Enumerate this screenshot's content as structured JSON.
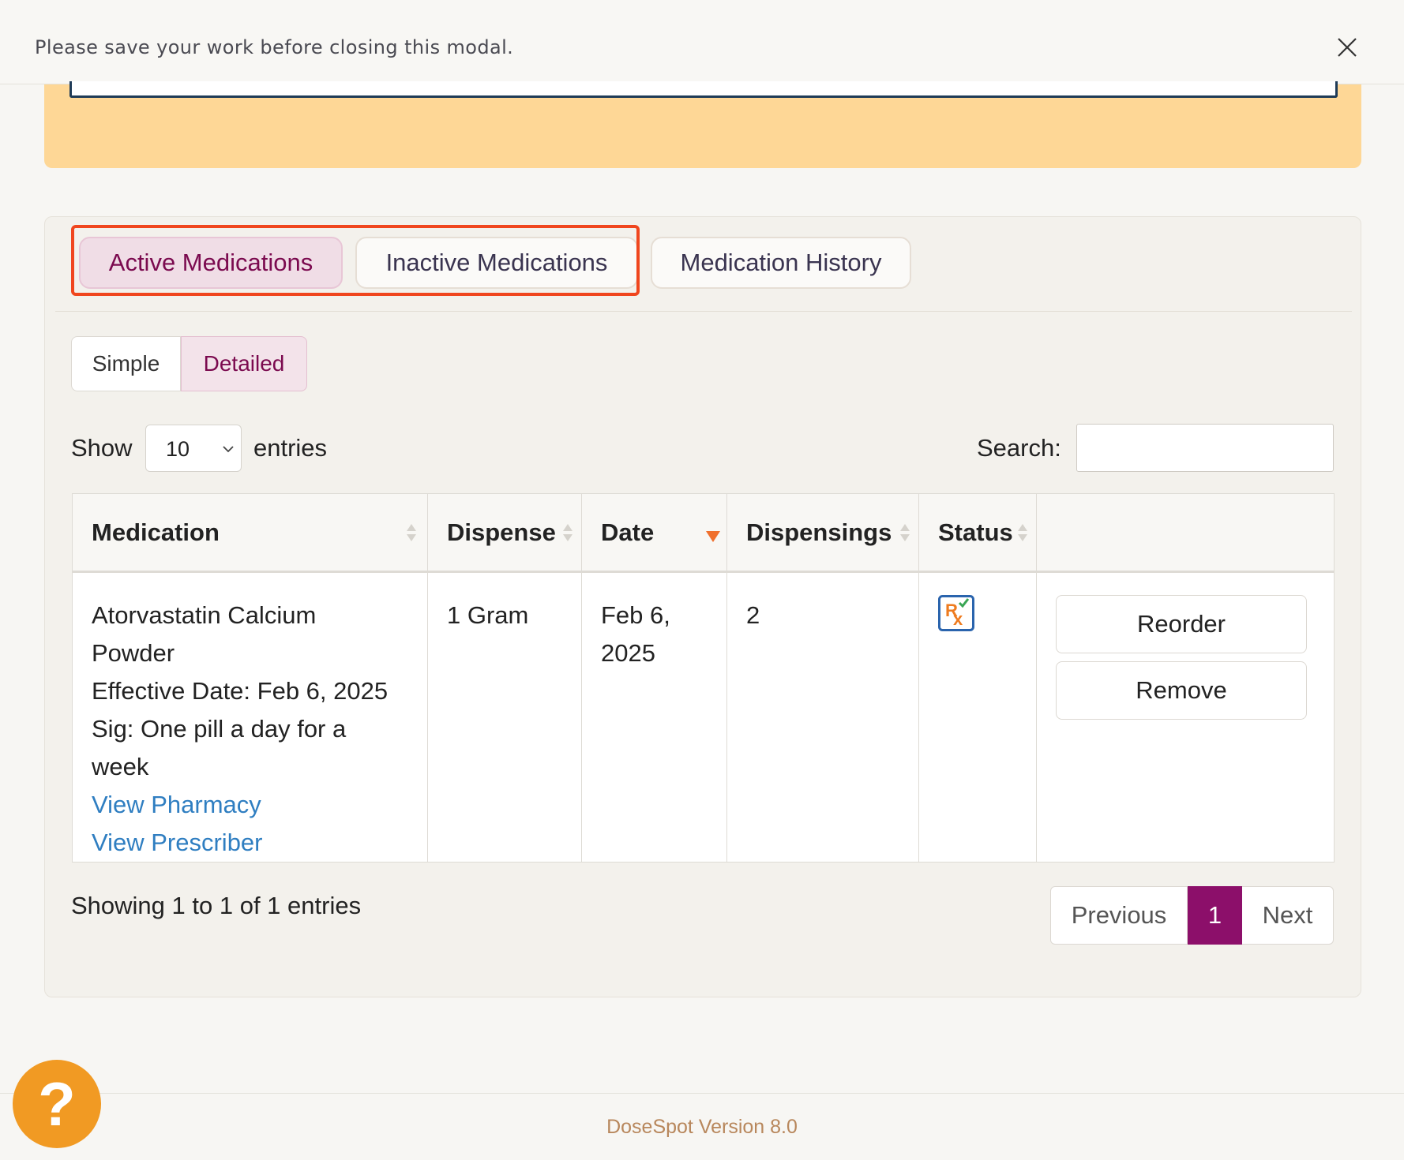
{
  "banner": {
    "message": "Please save your work before closing this modal."
  },
  "tabs": [
    {
      "label": "Active Medications",
      "active": true
    },
    {
      "label": "Inactive Medications",
      "active": false
    },
    {
      "label": "Medication History",
      "active": false
    }
  ],
  "view_toggle": {
    "simple": "Simple",
    "detailed": "Detailed",
    "selected": "Detailed"
  },
  "length": {
    "show_label": "Show",
    "value": "10",
    "entries_label": "entries"
  },
  "search": {
    "label": "Search:",
    "value": ""
  },
  "table": {
    "columns": [
      "Medication",
      "Dispense",
      "Date",
      "Dispensings",
      "Status",
      ""
    ],
    "sorted_column": "Date",
    "sort_direction": "descending",
    "rows": [
      {
        "medication_name": "Atorvastatin Calcium",
        "medication_name_2": "Powder",
        "effective_date": "Effective Date: Feb 6, 2025",
        "sig_1": "Sig: One pill a day for a",
        "sig_2": "week",
        "view_pharmacy": "View Pharmacy",
        "view_prescriber": "View Prescriber",
        "dispense": "1 Gram",
        "date_1": "Feb 6,",
        "date_2": "2025",
        "dispensings": "2",
        "status_icon": "rx-icon",
        "reorder": "Reorder",
        "remove": "Remove"
      }
    ]
  },
  "info": "Showing 1 to 1 of 1 entries",
  "pagination": {
    "previous": "Previous",
    "current": "1",
    "next": "Next"
  },
  "footer": "DoseSpot Version 8.0",
  "help": {
    "icon": "question-icon",
    "label": "?"
  },
  "colors": {
    "accent": "#8c0f6a",
    "highlight": "#f0461e",
    "notice": "#fed796",
    "help": "#f19a23",
    "link": "#2f7ec1"
  }
}
